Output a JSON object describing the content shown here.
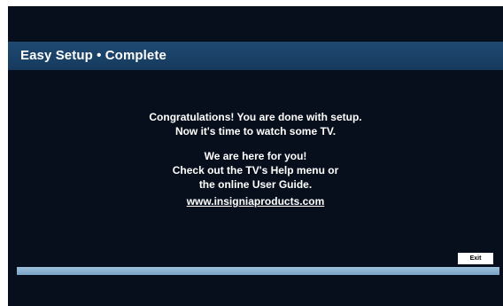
{
  "header": {
    "title": "Easy Setup • Complete"
  },
  "message": {
    "line1": "Congratulations! You are done with setup.",
    "line2": "Now it's time to watch some TV.",
    "line3": "We are here for you!",
    "line4": "Check out the TV's Help menu or",
    "line5": "the online User Guide.",
    "link": "www.insigniaproducts.com"
  },
  "controls": {
    "exit_label": "Exit"
  },
  "progress": {
    "value_percent": 100
  },
  "colors": {
    "background": "#080f1c",
    "title_bar": "#1f4a73",
    "progress_fill": "#8fb5d3",
    "text": "#ffffff"
  }
}
